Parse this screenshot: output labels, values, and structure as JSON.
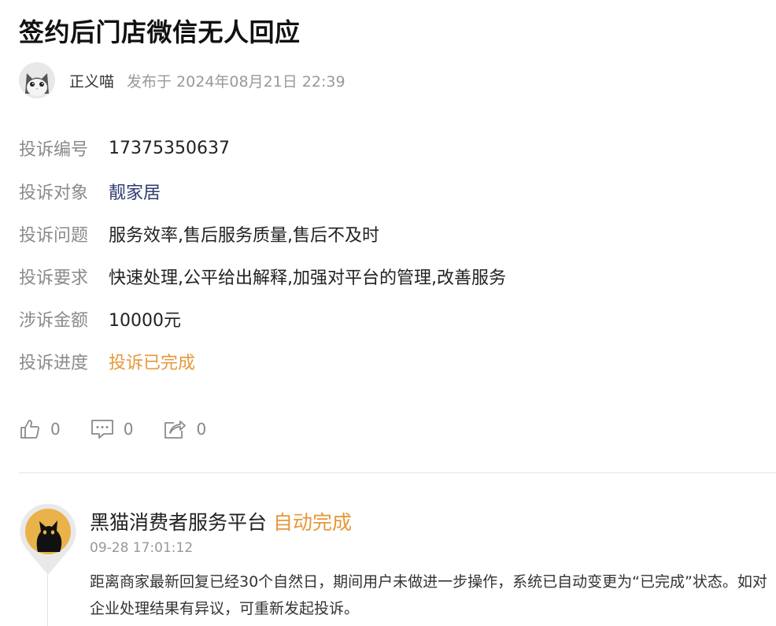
{
  "article": {
    "title": "签约后门店微信无人回应",
    "author": "正义喵",
    "publish_label": "发布于 2024年08月21日 22:39"
  },
  "complaint": {
    "fields": [
      {
        "label": "投诉编号",
        "value": "17375350637"
      },
      {
        "label": "投诉对象",
        "value": "靓家居"
      },
      {
        "label": "投诉问题",
        "value": "服务效率,售后服务质量,售后不及时"
      },
      {
        "label": "投诉要求",
        "value": "快速处理,公平给出解释,加强对平台的管理,改善服务"
      },
      {
        "label": "涉诉金额",
        "value": "10000元"
      },
      {
        "label": "投诉进度",
        "value": "投诉已完成"
      }
    ]
  },
  "actions": {
    "like": {
      "icon": "thumbs-up-icon",
      "count": "0"
    },
    "comment": {
      "icon": "comment-icon",
      "count": "0"
    },
    "share": {
      "icon": "share-icon",
      "count": "0"
    }
  },
  "reply": {
    "name": "黑猫消费者服务平台",
    "status": "自动完成",
    "time": "09-28 17:01:12",
    "text": "距离商家最新回复已经30个自然日，期间用户未做进一步操作，系统已自动变更为“已完成”状态。如对企业处理结果有异议，可重新发起投诉。"
  },
  "colors": {
    "accent_orange": "#e6983a",
    "link_blue": "#2f3d6f",
    "label_gray": "#8a8a8a"
  }
}
